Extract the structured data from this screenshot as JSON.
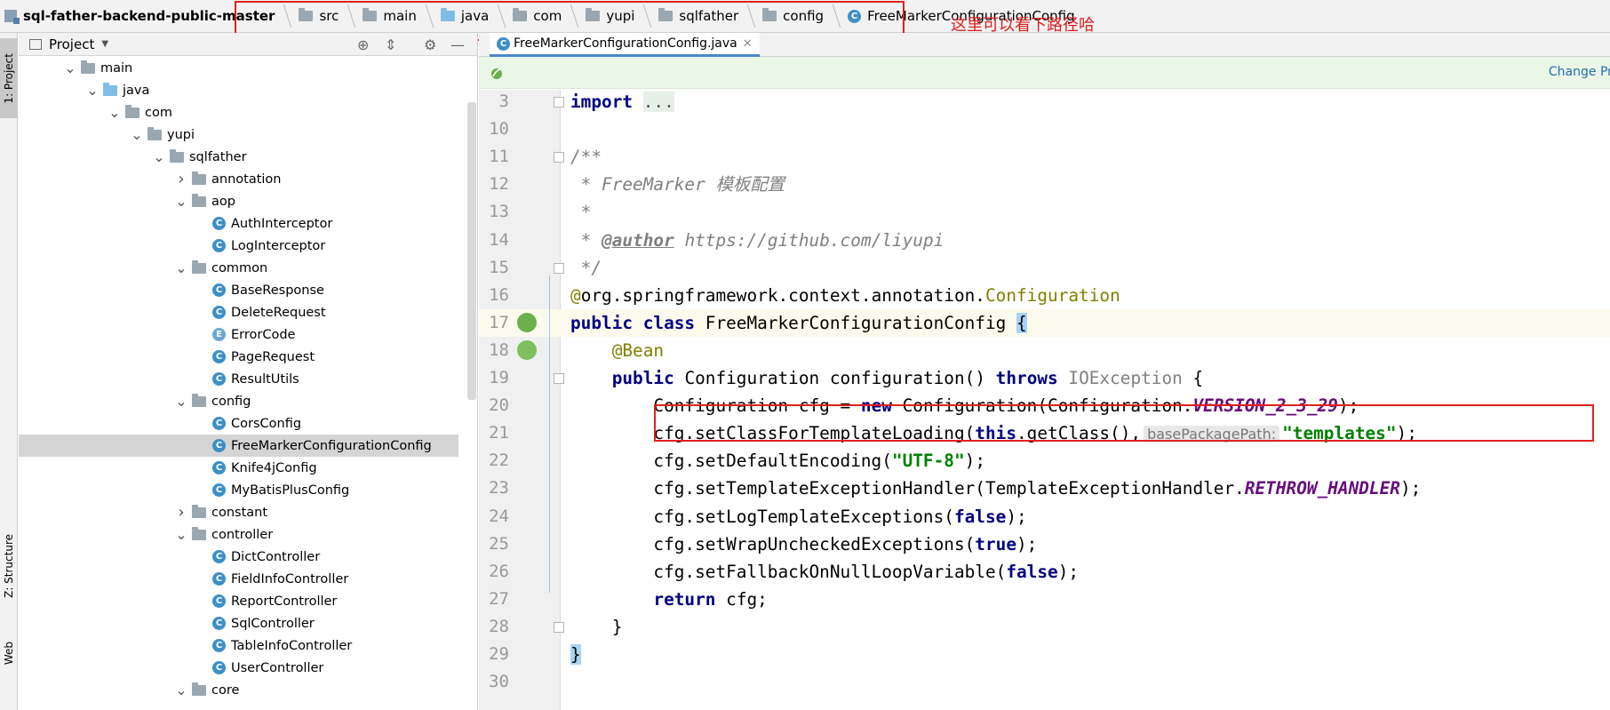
{
  "breadcrumb": {
    "root": "sql-father-backend-public-master",
    "items": [
      "src",
      "main",
      "java",
      "com",
      "yupi",
      "sqlfather",
      "config"
    ],
    "file": "FreeMarkerConfigurationConfig"
  },
  "annotation": "这里可以看下路径哈",
  "tool_strip": {
    "project": "1: Project",
    "structure": "Z: Structure",
    "web": "Web"
  },
  "project_panel": {
    "title": "Project",
    "tree": [
      {
        "label": "main",
        "depth": 2,
        "type": "folder",
        "arrow": "open"
      },
      {
        "label": "java",
        "depth": 3,
        "type": "folder-blue",
        "arrow": "open"
      },
      {
        "label": "com",
        "depth": 4,
        "type": "package",
        "arrow": "open"
      },
      {
        "label": "yupi",
        "depth": 5,
        "type": "package",
        "arrow": "open"
      },
      {
        "label": "sqlfather",
        "depth": 6,
        "type": "package",
        "arrow": "open"
      },
      {
        "label": "annotation",
        "depth": 7,
        "type": "package",
        "arrow": "closed"
      },
      {
        "label": "aop",
        "depth": 7,
        "type": "package",
        "arrow": "open"
      },
      {
        "label": "AuthInterceptor",
        "depth": 8,
        "type": "class"
      },
      {
        "label": "LogInterceptor",
        "depth": 8,
        "type": "class"
      },
      {
        "label": "common",
        "depth": 7,
        "type": "package",
        "arrow": "open"
      },
      {
        "label": "BaseResponse",
        "depth": 8,
        "type": "class"
      },
      {
        "label": "DeleteRequest",
        "depth": 8,
        "type": "class"
      },
      {
        "label": "ErrorCode",
        "depth": 8,
        "type": "enum"
      },
      {
        "label": "PageRequest",
        "depth": 8,
        "type": "class"
      },
      {
        "label": "ResultUtils",
        "depth": 8,
        "type": "class"
      },
      {
        "label": "config",
        "depth": 7,
        "type": "package",
        "arrow": "open"
      },
      {
        "label": "CorsConfig",
        "depth": 8,
        "type": "class"
      },
      {
        "label": "FreeMarkerConfigurationConfig",
        "depth": 8,
        "type": "class",
        "selected": true
      },
      {
        "label": "Knife4jConfig",
        "depth": 8,
        "type": "class"
      },
      {
        "label": "MyBatisPlusConfig",
        "depth": 8,
        "type": "class"
      },
      {
        "label": "constant",
        "depth": 7,
        "type": "package",
        "arrow": "closed"
      },
      {
        "label": "controller",
        "depth": 7,
        "type": "package",
        "arrow": "open"
      },
      {
        "label": "DictController",
        "depth": 8,
        "type": "class"
      },
      {
        "label": "FieldInfoController",
        "depth": 8,
        "type": "class"
      },
      {
        "label": "ReportController",
        "depth": 8,
        "type": "class"
      },
      {
        "label": "SqlController",
        "depth": 8,
        "type": "class"
      },
      {
        "label": "TableInfoController",
        "depth": 8,
        "type": "class"
      },
      {
        "label": "UserController",
        "depth": 8,
        "type": "class"
      },
      {
        "label": "core",
        "depth": 7,
        "type": "package",
        "arrow": "open"
      }
    ]
  },
  "editor": {
    "tab_label": "FreeMarkerConfigurationConfig.java",
    "banner_link": "Change Profi",
    "hint_label": "basePackagePath:",
    "lines": [
      {
        "n": "3",
        "parts": [
          [
            "kw",
            "import"
          ],
          [
            "t",
            " "
          ],
          [
            "fold",
            "..."
          ]
        ]
      },
      {
        "n": "10",
        "parts": []
      },
      {
        "n": "11",
        "parts": [
          [
            "cm",
            "/**"
          ]
        ]
      },
      {
        "n": "12",
        "parts": [
          [
            "cm",
            " * FreeMarker 模板配置"
          ]
        ]
      },
      {
        "n": "13",
        "parts": [
          [
            "cm",
            " *"
          ]
        ]
      },
      {
        "n": "14",
        "parts": [
          [
            "cm",
            " * "
          ],
          [
            "tag",
            "@author"
          ],
          [
            "cm",
            " https://github.com/liyupi"
          ]
        ]
      },
      {
        "n": "15",
        "parts": [
          [
            "cm",
            " */"
          ]
        ]
      },
      {
        "n": "16",
        "parts": [
          [
            "an",
            "@"
          ],
          [
            "t",
            "org.springframework.context.annotation."
          ],
          [
            "an",
            "Configuration"
          ]
        ]
      },
      {
        "n": "17",
        "parts": [
          [
            "kw",
            "public class "
          ],
          [
            "t",
            "FreeMarkerConfigurationConfig "
          ],
          [
            "brace",
            "{"
          ]
        ]
      },
      {
        "n": "18",
        "parts": [
          [
            "t",
            "    "
          ],
          [
            "an",
            "@Bean"
          ]
        ]
      },
      {
        "n": "19",
        "parts": [
          [
            "t",
            "    "
          ],
          [
            "kw",
            "public "
          ],
          [
            "t",
            "Configuration configuration() "
          ],
          [
            "kw",
            "throws "
          ],
          [
            "un",
            "IOException"
          ],
          [
            "t",
            " {"
          ]
        ]
      },
      {
        "n": "20",
        "parts": [
          [
            "t",
            "        Configuration cfg = "
          ],
          [
            "kw",
            "new "
          ],
          [
            "t",
            "Configuration(Configuration."
          ],
          [
            "cn",
            "VERSION_2_3_29"
          ],
          [
            "t",
            ");"
          ]
        ]
      },
      {
        "n": "21",
        "parts": [
          [
            "t",
            "        cfg.setClassForTemplateLoading("
          ],
          [
            "kw",
            "this"
          ],
          [
            "t",
            ".getClass(),"
          ],
          [
            "hint",
            "basePackagePath:"
          ],
          [
            "st",
            "\"templates\""
          ],
          [
            "t",
            ");"
          ]
        ]
      },
      {
        "n": "22",
        "parts": [
          [
            "t",
            "        cfg.setDefaultEncoding("
          ],
          [
            "st",
            "\"UTF-8\""
          ],
          [
            "t",
            ");"
          ]
        ]
      },
      {
        "n": "23",
        "parts": [
          [
            "t",
            "        cfg.setTemplateExceptionHandler(TemplateExceptionHandler."
          ],
          [
            "cn",
            "RETHROW_HANDLER"
          ],
          [
            "t",
            ");"
          ]
        ]
      },
      {
        "n": "24",
        "parts": [
          [
            "t",
            "        cfg.setLogTemplateExceptions("
          ],
          [
            "kw",
            "false"
          ],
          [
            "t",
            ");"
          ]
        ]
      },
      {
        "n": "25",
        "parts": [
          [
            "t",
            "        cfg.setWrapUncheckedExceptions("
          ],
          [
            "kw",
            "true"
          ],
          [
            "t",
            ");"
          ]
        ]
      },
      {
        "n": "26",
        "parts": [
          [
            "t",
            "        cfg.setFallbackOnNullLoopVariable("
          ],
          [
            "kw",
            "false"
          ],
          [
            "t",
            ");"
          ]
        ]
      },
      {
        "n": "27",
        "parts": [
          [
            "t",
            "        "
          ],
          [
            "kw",
            "return "
          ],
          [
            "t",
            "cfg;"
          ]
        ]
      },
      {
        "n": "28",
        "parts": [
          [
            "t",
            "    }"
          ]
        ]
      },
      {
        "n": "29",
        "parts": [
          [
            "brace",
            "}"
          ]
        ]
      },
      {
        "n": "30",
        "parts": []
      }
    ]
  }
}
